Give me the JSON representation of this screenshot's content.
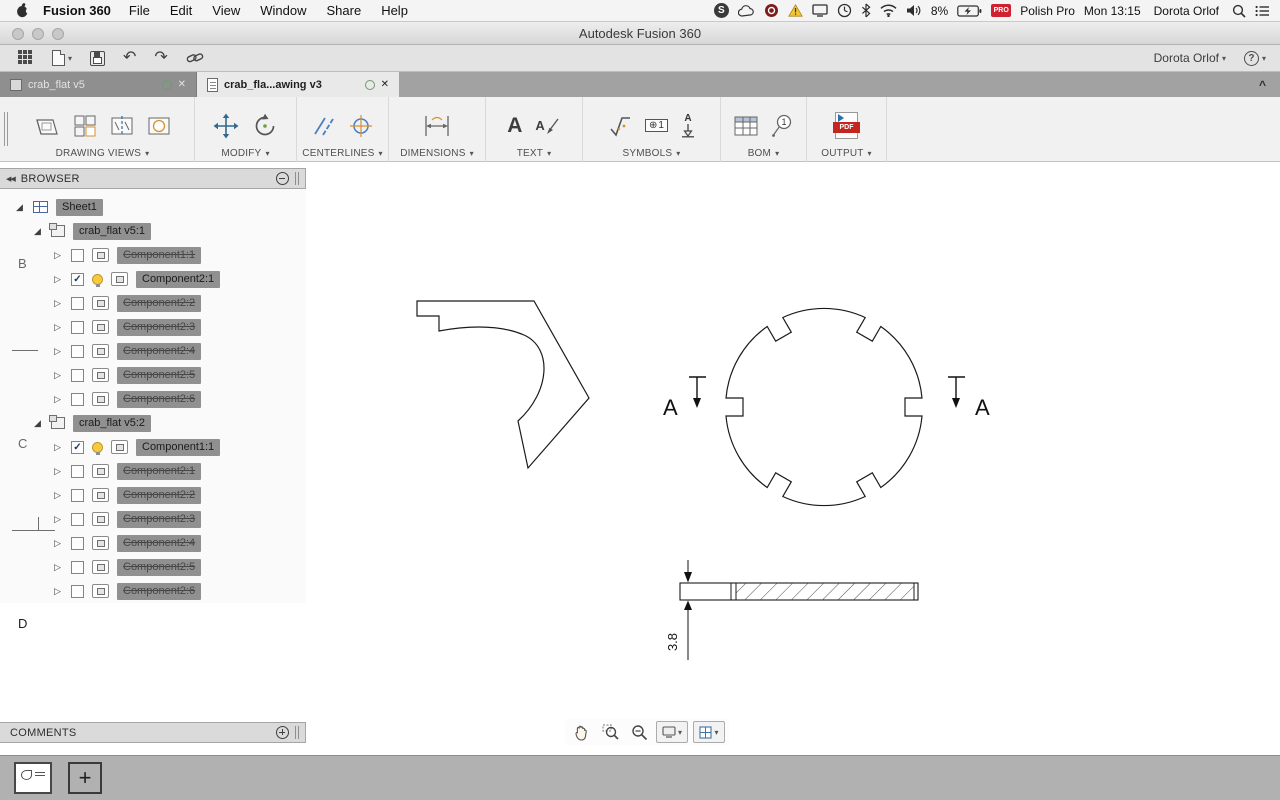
{
  "icons": {
    "dropdown": "▾",
    "expanded": "◢",
    "collapsed": "▷",
    "check": "✓",
    "close": "✕",
    "collapse_panel": "◀◀",
    "collapse_ribbon": "^",
    "help": "?",
    "skype": "S"
  },
  "menubar": {
    "app_name": "Fusion 360",
    "menus": [
      "File",
      "Edit",
      "View",
      "Window",
      "Share",
      "Help"
    ],
    "battery_percent": "8%",
    "input_badge": "PRO",
    "input_label": "Polish Pro",
    "clock": "Mon 13:15",
    "user": "Dorota Orlof"
  },
  "window": {
    "title": "Autodesk Fusion 360"
  },
  "toolbar": {
    "user_menu": "Dorota Orlof"
  },
  "tabs": [
    {
      "label": "crab_flat v5",
      "active": false
    },
    {
      "label": "crab_fla...awing v3",
      "active": true
    }
  ],
  "ribbon_groups": [
    {
      "label": "DRAWING VIEWS"
    },
    {
      "label": "MODIFY"
    },
    {
      "label": "CENTERLINES"
    },
    {
      "label": "DIMENSIONS"
    },
    {
      "label": "TEXT"
    },
    {
      "label": "SYMBOLS"
    },
    {
      "label": "BOM"
    },
    {
      "label": "OUTPUT"
    }
  ],
  "ribbon_icons": {
    "text_letter": "A",
    "leader_letter": "A",
    "frame_symbol": "⊕",
    "frame_number": "1",
    "datum_letter": "A",
    "balloon_number": "1",
    "pdf": "PDF"
  },
  "browser": {
    "title": "BROWSER",
    "tree": [
      {
        "label": "Sheet1",
        "kind": "sheet",
        "indent": 0,
        "expanded": true
      },
      {
        "label": "crab_flat v5:1",
        "kind": "assembly",
        "indent": 1,
        "expanded": true
      },
      {
        "label": "Component1:1",
        "kind": "component",
        "indent": 2,
        "expanded": false,
        "checked": false,
        "bulb": false,
        "struck": true
      },
      {
        "label": "Component2:1",
        "kind": "component",
        "indent": 2,
        "expanded": false,
        "checked": true,
        "bulb": true,
        "struck": false
      },
      {
        "label": "Component2:2",
        "kind": "component",
        "indent": 2,
        "expanded": false,
        "checked": false,
        "bulb": false,
        "struck": true
      },
      {
        "label": "Component2:3",
        "kind": "component",
        "indent": 2,
        "expanded": false,
        "checked": false,
        "bulb": false,
        "struck": true
      },
      {
        "label": "Component2:4",
        "kind": "component",
        "indent": 2,
        "expanded": false,
        "checked": false,
        "bulb": false,
        "struck": true
      },
      {
        "label": "Component2:5",
        "kind": "component",
        "indent": 2,
        "expanded": false,
        "checked": false,
        "bulb": false,
        "struck": true
      },
      {
        "label": "Component2:6",
        "kind": "component",
        "indent": 2,
        "expanded": false,
        "checked": false,
        "bulb": false,
        "struck": true
      },
      {
        "label": "crab_flat v5:2",
        "kind": "assembly",
        "indent": 1,
        "expanded": true
      },
      {
        "label": "Component1:1",
        "kind": "component",
        "indent": 2,
        "expanded": false,
        "checked": true,
        "bulb": true,
        "struck": false
      },
      {
        "label": "Component2:1",
        "kind": "component",
        "indent": 2,
        "expanded": false,
        "checked": false,
        "bulb": false,
        "struck": true
      },
      {
        "label": "Component2:2",
        "kind": "component",
        "indent": 2,
        "expanded": false,
        "checked": false,
        "bulb": false,
        "struck": true
      },
      {
        "label": "Component2:3",
        "kind": "component",
        "indent": 2,
        "expanded": false,
        "checked": false,
        "bulb": false,
        "struck": true
      },
      {
        "label": "Component2:4",
        "kind": "component",
        "indent": 2,
        "expanded": false,
        "checked": false,
        "bulb": false,
        "struck": true
      },
      {
        "label": "Component2:5",
        "kind": "component",
        "indent": 2,
        "expanded": false,
        "checked": false,
        "bulb": false,
        "struck": true
      },
      {
        "label": "Component2:6",
        "kind": "component",
        "indent": 2,
        "expanded": false,
        "checked": false,
        "bulb": false,
        "struck": true
      }
    ]
  },
  "comments": {
    "title": "COMMENTS"
  },
  "drawing": {
    "zone_labels": [
      "B",
      "C",
      "D"
    ],
    "section_label": "A",
    "thickness": "3.8"
  }
}
